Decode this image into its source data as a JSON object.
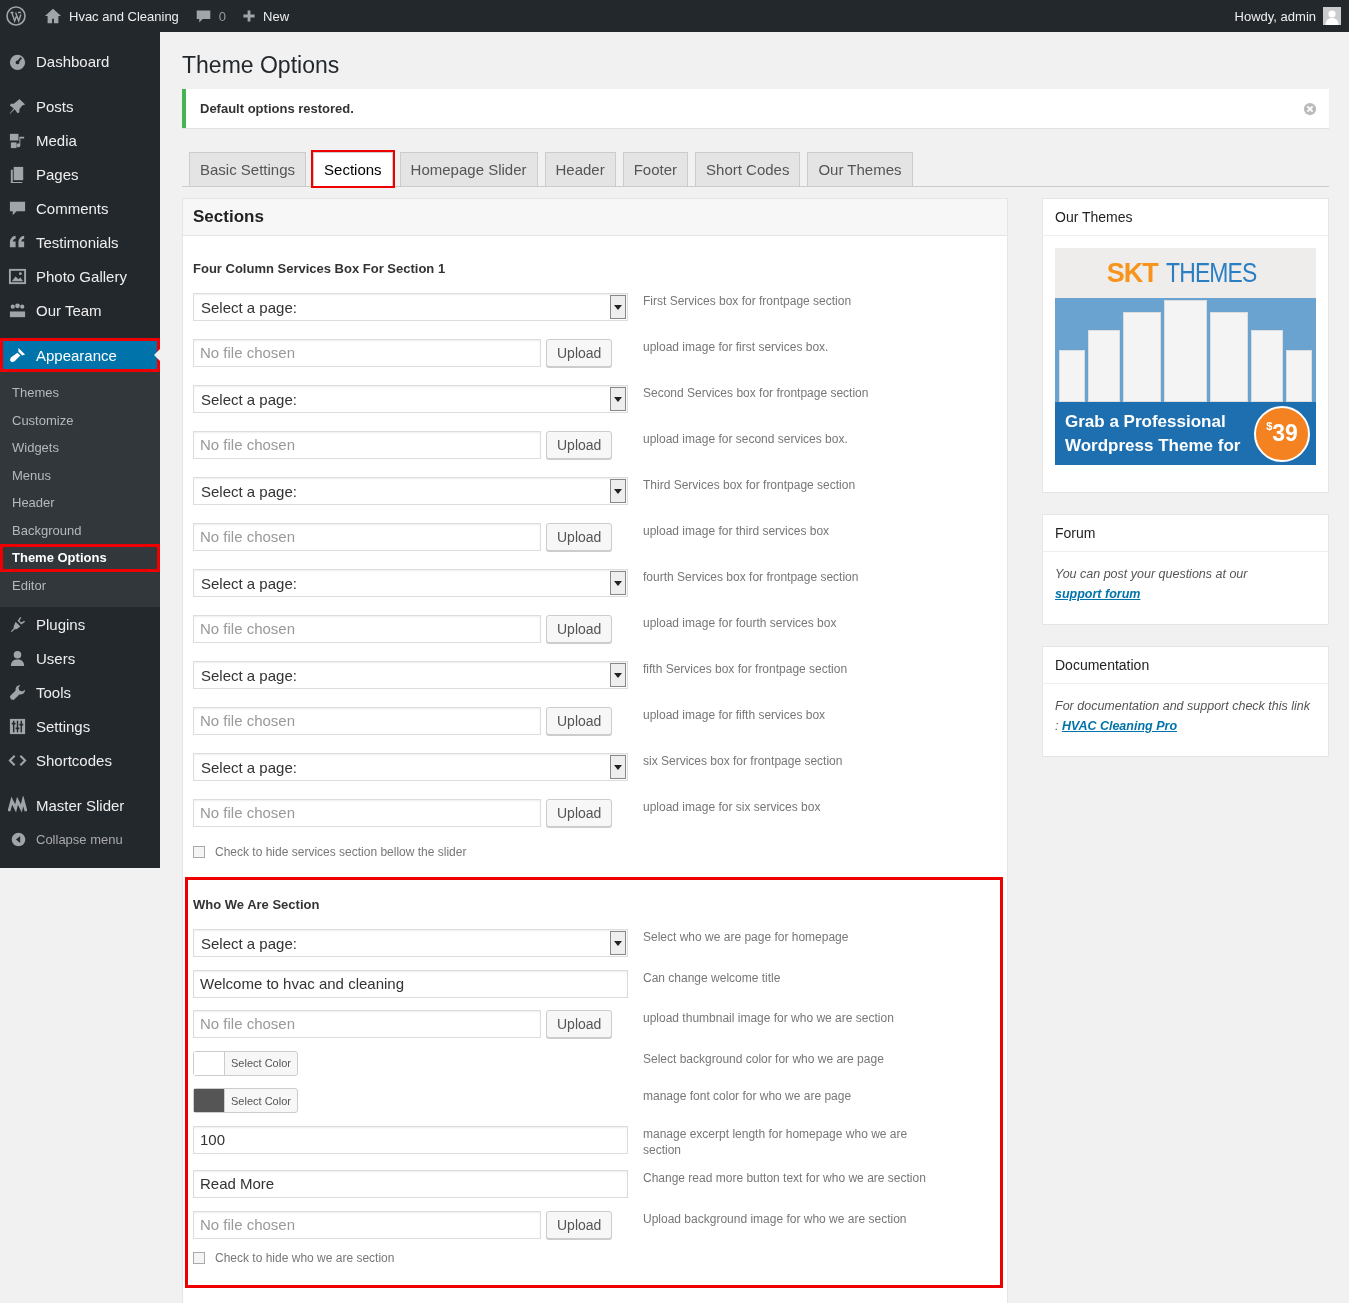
{
  "admin_bar": {
    "site_name": "Hvac and Cleaning",
    "comments_count": "0",
    "new_label": "New",
    "greeting": "Howdy, admin"
  },
  "sidebar": {
    "items": [
      {
        "label": "Dashboard",
        "selected": false,
        "highlighted": false
      },
      {
        "label": "Posts",
        "selected": false,
        "highlighted": false
      },
      {
        "label": "Media",
        "selected": false,
        "highlighted": false
      },
      {
        "label": "Pages",
        "selected": false,
        "highlighted": false
      },
      {
        "label": "Comments",
        "selected": false,
        "highlighted": false
      },
      {
        "label": "Testimonials",
        "selected": false,
        "highlighted": false
      },
      {
        "label": "Photo Gallery",
        "selected": false,
        "highlighted": false
      },
      {
        "label": "Our Team",
        "selected": false,
        "highlighted": false
      },
      {
        "label": "Appearance",
        "selected": true,
        "highlighted": true,
        "children": [
          {
            "label": "Themes",
            "selected": false,
            "highlighted": false
          },
          {
            "label": "Customize",
            "selected": false,
            "highlighted": false
          },
          {
            "label": "Widgets",
            "selected": false,
            "highlighted": false
          },
          {
            "label": "Menus",
            "selected": false,
            "highlighted": false
          },
          {
            "label": "Header",
            "selected": false,
            "highlighted": false
          },
          {
            "label": "Background",
            "selected": false,
            "highlighted": false
          },
          {
            "label": "Theme Options",
            "selected": true,
            "highlighted": true
          },
          {
            "label": "Editor",
            "selected": false,
            "highlighted": false
          }
        ]
      },
      {
        "label": "Plugins",
        "selected": false,
        "highlighted": false
      },
      {
        "label": "Users",
        "selected": false,
        "highlighted": false
      },
      {
        "label": "Tools",
        "selected": false,
        "highlighted": false
      },
      {
        "label": "Settings",
        "selected": false,
        "highlighted": false
      },
      {
        "label": "Shortcodes",
        "selected": false,
        "highlighted": false
      },
      {
        "label": "Master Slider",
        "selected": false,
        "highlighted": false
      }
    ],
    "collapse_label": "Collapse menu"
  },
  "page": {
    "title": "Theme Options",
    "notice": "Default options restored.",
    "tabs": [
      {
        "label": "Basic Settings",
        "selected": false,
        "highlighted": false
      },
      {
        "label": "Sections",
        "selected": true,
        "highlighted": true
      },
      {
        "label": "Homepage Slider",
        "selected": false,
        "highlighted": false
      },
      {
        "label": "Header",
        "selected": false,
        "highlighted": false
      },
      {
        "label": "Footer",
        "selected": false,
        "highlighted": false
      },
      {
        "label": "Short Codes",
        "selected": false,
        "highlighted": false
      },
      {
        "label": "Our Themes",
        "selected": false,
        "highlighted": false
      }
    ],
    "panel": {
      "title": "Sections",
      "groups": [
        {
          "title": "Four Column Services Box For Section 1",
          "highlighted": false,
          "rows": [
            {
              "kind": "select",
              "value": "Select a page:",
              "description": "First Services box for frontpage section"
            },
            {
              "kind": "file",
              "placeholder": "No file chosen",
              "button": "Upload",
              "description": "upload image for first services box."
            },
            {
              "kind": "select",
              "value": "Select a page:",
              "description": "Second Services box for frontpage section"
            },
            {
              "kind": "file",
              "placeholder": "No file chosen",
              "button": "Upload",
              "description": "upload image for second services box."
            },
            {
              "kind": "select",
              "value": "Select a page:",
              "description": "Third Services box for frontpage section"
            },
            {
              "kind": "file",
              "placeholder": "No file chosen",
              "button": "Upload",
              "description": "upload image for third services box"
            },
            {
              "kind": "select",
              "value": "Select a page:",
              "description": "fourth Services box for frontpage section"
            },
            {
              "kind": "file",
              "placeholder": "No file chosen",
              "button": "Upload",
              "description": "upload image for fourth services box"
            },
            {
              "kind": "select",
              "value": "Select a page:",
              "description": "fifth Services box for frontpage section"
            },
            {
              "kind": "file",
              "placeholder": "No file chosen",
              "button": "Upload",
              "description": "upload image for fifth services box"
            },
            {
              "kind": "select",
              "value": "Select a page:",
              "description": "six Services box for frontpage section"
            },
            {
              "kind": "file",
              "placeholder": "No file chosen",
              "button": "Upload",
              "description": "upload image for six services box"
            },
            {
              "kind": "checkbox",
              "label": "Check to hide services section bellow the slider",
              "checked": false
            }
          ]
        },
        {
          "title": "Who We Are Section",
          "highlighted": true,
          "rows": [
            {
              "kind": "select",
              "value": "Select a page:",
              "description": "Select who we are page for homepage"
            },
            {
              "kind": "text",
              "value": "Welcome to  hvac and cleaning",
              "description": "Can change welcome title"
            },
            {
              "kind": "file",
              "placeholder": "No file chosen",
              "button": "Upload",
              "description": "upload thumbnail image for who we are section"
            },
            {
              "kind": "color",
              "color": "#ffffff",
              "button": "Select Color",
              "description": "Select background color for who we are page"
            },
            {
              "kind": "color",
              "color": "#555555",
              "button": "Select Color",
              "description": "manage font color for who we are page"
            },
            {
              "kind": "text",
              "value": "100",
              "description": "manage excerpt length for homepage who we are section"
            },
            {
              "kind": "text",
              "value": "Read More",
              "description": "Change read more button text for who we are section"
            },
            {
              "kind": "file",
              "placeholder": "No file chosen",
              "button": "Upload",
              "description": "Upload background image for who we are section"
            },
            {
              "kind": "checkbox",
              "label": "Check to hide who we are section",
              "checked": false
            }
          ]
        }
      ]
    }
  },
  "side_boxes": [
    {
      "kind": "banner",
      "title": "Our Themes",
      "banner": {
        "logo_left": "SKT",
        "logo_right": "THEMES",
        "line_1": "Grab a Professional",
        "line_2": "Wordpress Theme for",
        "currency": "$",
        "price": "39"
      }
    },
    {
      "kind": "text",
      "title": "Forum",
      "text": "You can post your questions at our ",
      "link": "support forum"
    },
    {
      "kind": "text",
      "title": "Documentation",
      "text": "For documentation and support check this link : ",
      "link": "HVAC Cleaning Pro"
    }
  ]
}
